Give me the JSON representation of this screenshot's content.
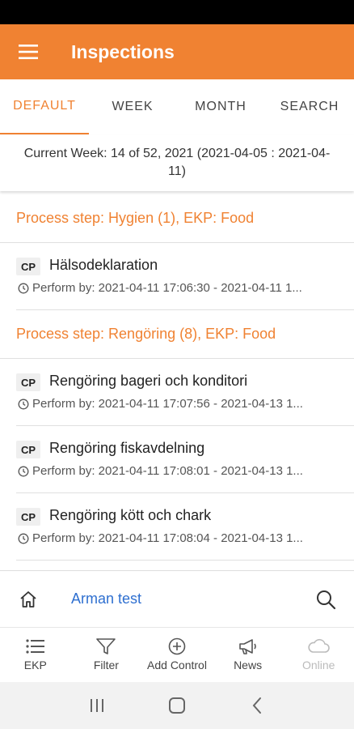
{
  "app_bar": {
    "title": "Inspections",
    "menu_icon": "hamburger-menu-icon"
  },
  "tabs": [
    {
      "label": "DEFAULT",
      "active": true
    },
    {
      "label": "WEEK",
      "active": false
    },
    {
      "label": "MONTH",
      "active": false
    },
    {
      "label": "SEARCH",
      "active": false
    }
  ],
  "week_info": "Current Week: 14 of 52, 2021 (2021-04-05 : 2021-04-11)",
  "groups": [
    {
      "header": "Process step: Hygien (1), EKP: Food",
      "items": [
        {
          "badge": "CP",
          "title": "Hälsodeklaration",
          "subtitle": "Perform by: 2021-04-11 17:06:30 - 2021-04-11 1..."
        }
      ]
    },
    {
      "header": "Process step: Rengöring (8), EKP: Food",
      "items": [
        {
          "badge": "CP",
          "title": "Rengöring bageri och konditori",
          "subtitle": "Perform by: 2021-04-11 17:07:56 - 2021-04-13 1..."
        },
        {
          "badge": "CP",
          "title": "Rengöring fiskavdelning",
          "subtitle": "Perform by: 2021-04-11 17:08:01 - 2021-04-13 1..."
        },
        {
          "badge": "CP",
          "title": "Rengöring kött och chark",
          "subtitle": "Perform by: 2021-04-11 17:08:04 - 2021-04-13 1..."
        }
      ]
    }
  ],
  "user_bar": {
    "user_name": "Arman test",
    "home_icon": "home-icon",
    "search_icon": "search-icon"
  },
  "bottom_nav": [
    {
      "label": "EKP",
      "icon": "list-icon",
      "enabled": true
    },
    {
      "label": "Filter",
      "icon": "filter-icon",
      "enabled": true
    },
    {
      "label": "Add Control",
      "icon": "add-circle-icon",
      "enabled": true
    },
    {
      "label": "News",
      "icon": "megaphone-icon",
      "enabled": true
    },
    {
      "label": "Online",
      "icon": "cloud-icon",
      "enabled": false
    }
  ],
  "colors": {
    "accent": "#f08232",
    "link": "#2e6fd0",
    "status_bar": "#000000"
  }
}
